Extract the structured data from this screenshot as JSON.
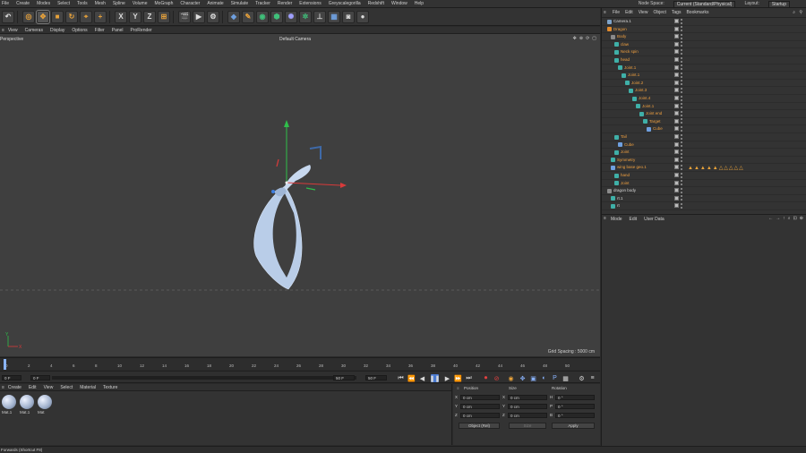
{
  "menubar": {
    "items": [
      "File",
      "Create",
      "Modes",
      "Select",
      "Tools",
      "Mesh",
      "Spline",
      "Volume",
      "MoGraph",
      "Character",
      "Animate",
      "Simulate",
      "Tracker",
      "Render",
      "Extensions",
      "Greyscalegorilla",
      "Redshift",
      "Window",
      "Help"
    ],
    "node_space_label": "Node Space:",
    "node_space_value": "Current (Standard/Physical)",
    "layout_label": "Layout:",
    "layout_value": "Startup"
  },
  "toolbar": {
    "icons": [
      "undo-icon",
      "move-live-select-icon",
      "move-icon",
      "scale-icon",
      "rotate-icon",
      "recent-tools-icon",
      "add-icon",
      "lock-x-icon",
      "lock-y-icon",
      "lock-z-icon",
      "world-coordinates-icon",
      "render-view-icon",
      "render-to-picture-viewer-icon",
      "render-settings-icon",
      "cube-icon",
      "pen-icon",
      "subdivision-surface-icon",
      "cloner-icon",
      "deformer-icon",
      "field-icon",
      "scene-icon",
      "camera-icon",
      "light-icon"
    ],
    "axis_letters": [
      "X",
      "Y",
      "Z"
    ]
  },
  "viewport": {
    "menu": [
      "View",
      "Cameras",
      "Display",
      "Options",
      "Filter",
      "Panel",
      "ProRender"
    ],
    "projection": "Perspective",
    "camera": "Default Camera",
    "grid_spacing": "Grid Spacing : 5000 cm",
    "axis_labels": [
      "Y",
      "X"
    ]
  },
  "timeline": {
    "ticks": [
      "0",
      "2",
      "4",
      "6",
      "8",
      "10",
      "12",
      "14",
      "16",
      "18",
      "20",
      "22",
      "24",
      "26",
      "28",
      "30",
      "32",
      "34",
      "36",
      "38",
      "40",
      "42",
      "44",
      "46",
      "48",
      "50"
    ],
    "current_frame_field": "0 F",
    "start_field": "0 F",
    "start_field_2": "0 F",
    "end_field": "50 F",
    "end_field_2": "50 F"
  },
  "materials": {
    "menu": [
      "Create",
      "Edit",
      "View",
      "Select",
      "Material",
      "Texture"
    ],
    "items": [
      "Mat.1",
      "Mat.1",
      "Mat"
    ]
  },
  "coordinates": {
    "headers": [
      "Position",
      "Size",
      "Rotation"
    ],
    "rows": [
      {
        "axis": "X",
        "pos": "0 cm",
        "size_axis": "X",
        "size": "0 cm",
        "rot_axis": "H",
        "rot": "0 °"
      },
      {
        "axis": "Y",
        "pos": "0 cm",
        "size_axis": "Y",
        "size": "0 cm",
        "rot_axis": "P",
        "rot": "0 °"
      },
      {
        "axis": "Z",
        "pos": "0 cm",
        "size_axis": "Z",
        "size": "0 cm",
        "rot_axis": "B",
        "rot": "0 °"
      }
    ],
    "mode": "Object (Rel)",
    "size_mode": "Size",
    "apply": "Apply"
  },
  "status": "Forwards (Shortcut F8)",
  "object_manager": {
    "menu": [
      "File",
      "Edit",
      "View",
      "Object",
      "Tags",
      "Bookmarks"
    ],
    "items": [
      {
        "name": "Camera.1",
        "indent": 0,
        "color": "#d8d8d8",
        "icon": "#7ea3c9",
        "tags": ""
      },
      {
        "name": "Dragon",
        "indent": 0,
        "color": "#f0a040",
        "icon": "#e08a2c",
        "tags": ""
      },
      {
        "name": "Body",
        "indent": 1,
        "color": "#f0a040",
        "icon": "#8a8a8a",
        "tags": ""
      },
      {
        "name": "claw",
        "indent": 2,
        "color": "#f0a040",
        "icon": "#3fb0a8",
        "tags": ""
      },
      {
        "name": "Neck spin",
        "indent": 2,
        "color": "#f0a040",
        "icon": "#3fb0a8",
        "tags": ""
      },
      {
        "name": "head",
        "indent": 2,
        "color": "#f0a040",
        "icon": "#3fb0a8",
        "tags": ""
      },
      {
        "name": "Joint.1",
        "indent": 3,
        "color": "#f0a040",
        "icon": "#3fb0a8",
        "tags": ""
      },
      {
        "name": "Joint.1",
        "indent": 4,
        "color": "#f0a040",
        "icon": "#3fb0a8",
        "tags": ""
      },
      {
        "name": "Joint.2",
        "indent": 5,
        "color": "#f0a040",
        "icon": "#3fb0a8",
        "tags": ""
      },
      {
        "name": "Joint.3",
        "indent": 6,
        "color": "#f0a040",
        "icon": "#3fb0a8",
        "tags": ""
      },
      {
        "name": "Joint.4",
        "indent": 7,
        "color": "#f0a040",
        "icon": "#3fb0a8",
        "tags": ""
      },
      {
        "name": "Joint.1",
        "indent": 8,
        "color": "#f0a040",
        "icon": "#3fb0a8",
        "tags": ""
      },
      {
        "name": "Joint end",
        "indent": 9,
        "color": "#f0a040",
        "icon": "#3fb0a8",
        "tags": ""
      },
      {
        "name": "Target",
        "indent": 10,
        "color": "#f0a040",
        "icon": "#3fb0a8",
        "tags": ""
      },
      {
        "name": "Cube",
        "indent": 11,
        "color": "#f0a040",
        "icon": "#6fa0e0",
        "tags": ""
      },
      {
        "name": "Tail",
        "indent": 2,
        "color": "#f0a040",
        "icon": "#3fb0a8",
        "tags": ""
      },
      {
        "name": "Cube",
        "indent": 3,
        "color": "#f0a040",
        "icon": "#6fa0e0",
        "tags": ""
      },
      {
        "name": "Joint",
        "indent": 2,
        "color": "#f0a040",
        "icon": "#3fb0a8",
        "tags": ""
      },
      {
        "name": "Symmetry",
        "indent": 1,
        "color": "#f0a040",
        "icon": "#3fb0a8",
        "tags": ""
      },
      {
        "name": "wing base geo.1",
        "indent": 1,
        "color": "#f0a040",
        "icon": "#6fa0e0",
        "tags": "▲▲▲▲▲△△△△△"
      },
      {
        "name": "hand",
        "indent": 2,
        "color": "#f0a040",
        "icon": "#3fb0a8",
        "tags": ""
      },
      {
        "name": "Joint",
        "indent": 2,
        "color": "#f0a040",
        "icon": "#3fb0a8",
        "tags": ""
      },
      {
        "name": "dragon body",
        "indent": 0,
        "color": "#d8d8d8",
        "icon": "#8a8a8a",
        "tags": ""
      },
      {
        "name": "rt.1",
        "indent": 1,
        "color": "#d8d8d8",
        "icon": "#3fb0a8",
        "tags": ""
      },
      {
        "name": "rt",
        "indent": 1,
        "color": "#d8d8d8",
        "icon": "#3fb0a8",
        "tags": ""
      }
    ]
  },
  "attribute_manager": {
    "menu": [
      "Mode",
      "Edit",
      "User Data"
    ]
  }
}
